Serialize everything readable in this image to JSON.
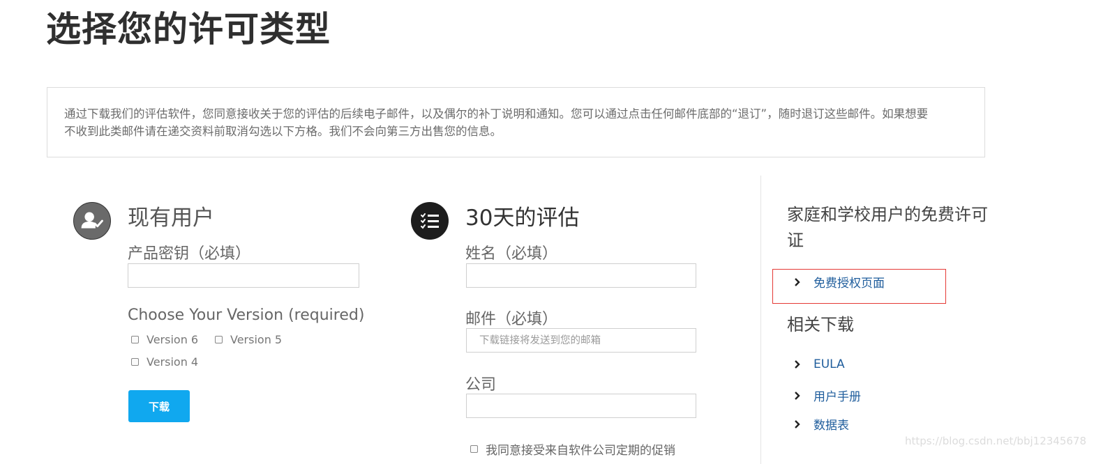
{
  "page_title": "选择您的许可类型",
  "notice": {
    "line1": "通过下载我们的评估软件，您同意接收关于您的评估的后续电子邮件，以及偶尔的补丁说明和通知。您可以通过点击任何邮件底部的“退订”，随时退订这些邮件。如果想要",
    "line2": "不收到此类邮件请在递交资料前取消勾选以下方格。我们不会向第三方出售您的信息。"
  },
  "existing_user": {
    "icon": "user-check-icon",
    "title": "现有用户",
    "product_key_label": "产品密钥（必填）",
    "product_key_value": "",
    "version_label": "Choose Your Version (required)",
    "versions": [
      "Version 6",
      "Version 5",
      "Version 4"
    ],
    "download_label": "下载"
  },
  "evaluation": {
    "icon": "checklist-icon",
    "title": "30天的评估",
    "name_label": "姓名（必填）",
    "name_value": "",
    "email_label": "邮件（必填）",
    "email_placeholder": "下载链接将发送到您的邮箱",
    "company_label": "公司",
    "company_value": "",
    "consent_label": "我同意接受来自软件公司定期的促销"
  },
  "sidebar": {
    "free_heading": "家庭和学校用户的免费许可证",
    "free_link": "免费授权页面",
    "related_heading": "相关下载",
    "related_links": [
      "EULA",
      "用户手册",
      "数据表"
    ]
  },
  "watermark": "https://blog.csdn.net/bbj12345678",
  "colors": {
    "accent_button": "#10a8ef",
    "link": "#1f5d9c",
    "highlight": "#e53935"
  }
}
